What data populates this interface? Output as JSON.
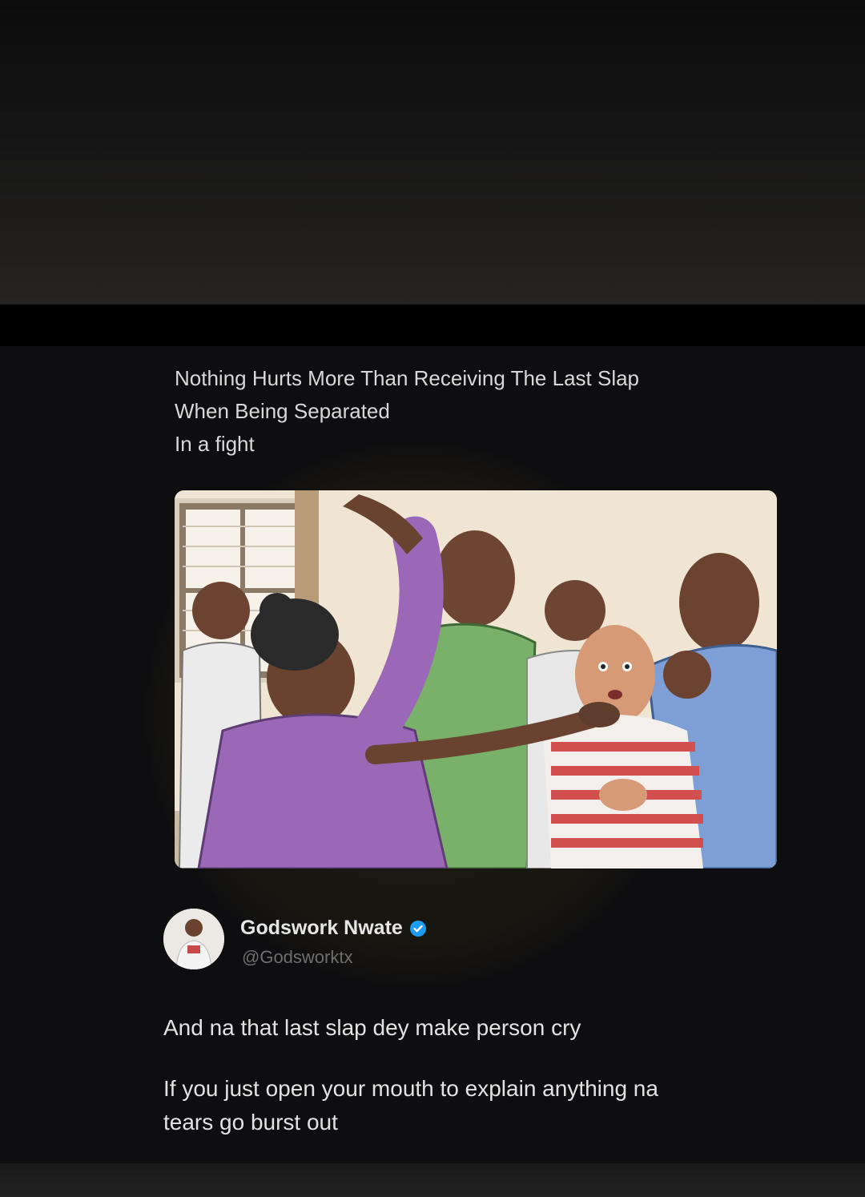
{
  "post": {
    "quoted_lines": [
      "Nothing Hurts More Than Receiving The Last Slap",
      "When Being Separated",
      "In a fight"
    ],
    "media": {
      "alt": "Illustration of people separating a fight while a woman raises her hand to slap a man"
    }
  },
  "author": {
    "display_name": "Godswork Nwate",
    "handle": "@Godsworktx",
    "verified": true,
    "verified_icon": "verified-badge-icon",
    "badge_color": "#1d9bf0"
  },
  "reply": {
    "line_1": "And na that last slap dey make person cry",
    "paragraph_2_line_1": "If you just open your mouth to explain anything na",
    "paragraph_2_line_2": "tears go burst out"
  }
}
